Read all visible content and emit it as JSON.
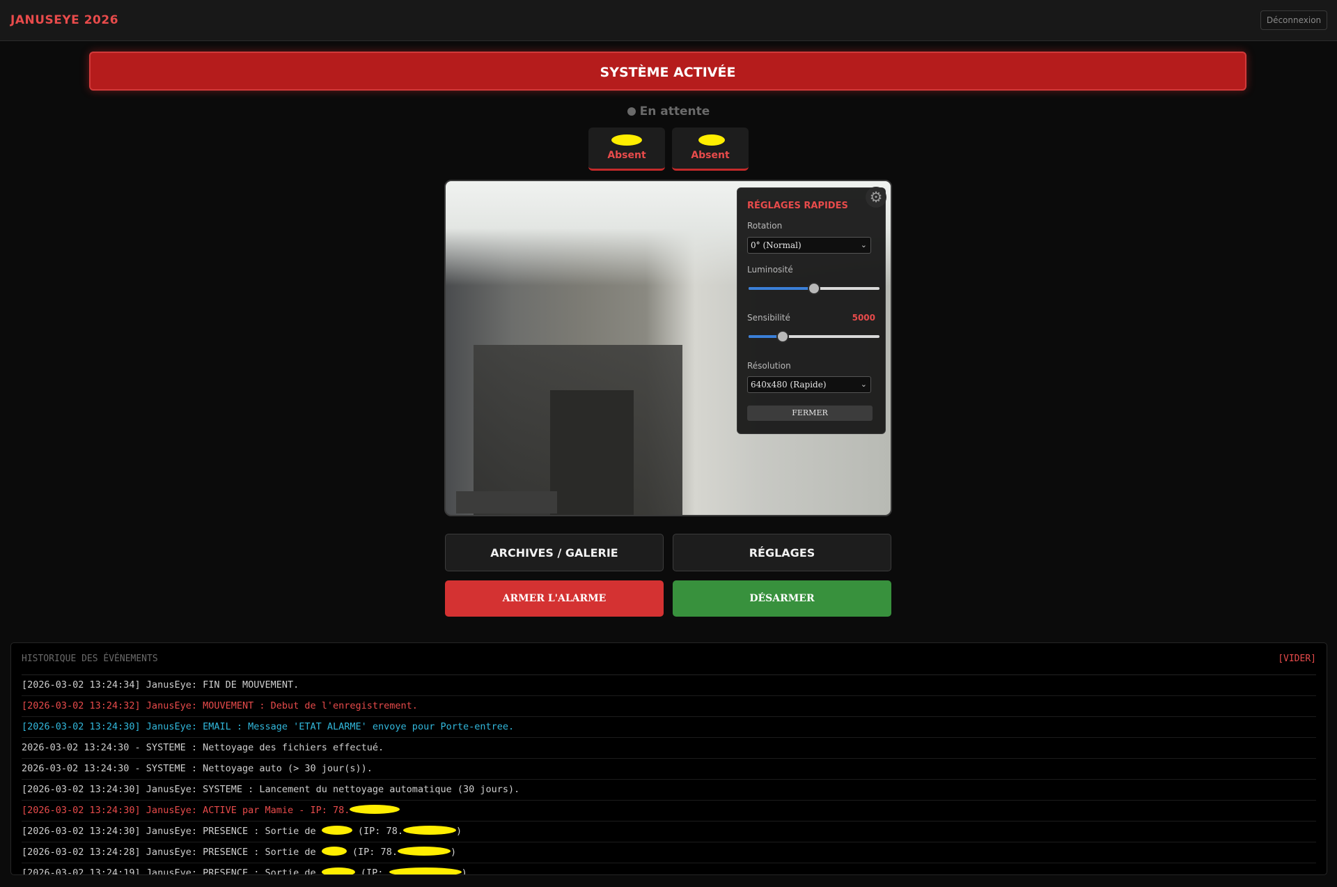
{
  "app": {
    "title": "JANUSEYE 2026",
    "logout_label": "Déconnexion"
  },
  "status": {
    "banner": "SYSTÈME ACTIVÉE",
    "waiting": "En attente"
  },
  "presence": [
    {
      "state": "Absent"
    },
    {
      "state": "Absent"
    }
  ],
  "quick_settings": {
    "title": "RÉGLAGES RAPIDES",
    "rotation_label": "Rotation",
    "rotation_value": "0° (Normal)",
    "brightness_label": "Luminosité",
    "brightness_level": 0.5,
    "sensitivity_label": "Sensibilité",
    "sensitivity_value": "5000",
    "sensitivity_level": 0.26,
    "resolution_label": "Résolution",
    "resolution_value": "640x480 (Rapide)",
    "close_label": "FERMER"
  },
  "actions": {
    "archives_label": "ARCHIVES / GALERIE",
    "settings_label": "RÉGLAGES",
    "arm_label": "ARMER L'ALARME",
    "disarm_label": "DÉSARMER"
  },
  "history": {
    "title": "HISTORIQUE DES ÉVÉNEMENTS",
    "clear_label": "[VIDER]",
    "entries": [
      {
        "text": "[2026-03-02 13:24:34] JanusEye: FIN DE MOUVEMENT.",
        "level": "info"
      },
      {
        "text": "[2026-03-02 13:24:32] JanusEye: MOUVEMENT : Debut de l'enregistrement.",
        "level": "alert"
      },
      {
        "text": "[2026-03-02 13:24:30] JanusEye: EMAIL : Message 'ETAT ALARME' envoye pour Porte-entree.",
        "level": "mail"
      },
      {
        "text": "2026-03-02 13:24:30 - SYSTEME : Nettoyage des fichiers effectué.",
        "level": "info"
      },
      {
        "text": "2026-03-02 13:24:30 - SYSTEME : Nettoyage auto (> 30 jour(s)).",
        "level": "info"
      },
      {
        "text": "[2026-03-02 13:24:30] JanusEye: SYSTEME : Lancement du nettoyage automatique (30 jours).",
        "level": "info"
      },
      {
        "text": "[2026-03-02 13:24:30] JanusEye: ACTIVE par Mamie - IP: 78.",
        "level": "alert"
      },
      {
        "text": "[2026-03-02 13:24:30] JanusEye: PRESENCE : Sortie de",
        "text_mid": "(IP: 78.",
        "text_end": ")",
        "level": "info"
      },
      {
        "text": "[2026-03-02 13:24:28] JanusEye: PRESENCE : Sortie de",
        "text_mid": "(IP: 78.",
        "text_end": ")",
        "level": "info"
      },
      {
        "text": "[2026-03-02 13:24:19] JanusEye: PRESENCE : Sortie de",
        "text_mid": "(IP:",
        "text_end": ")",
        "level": "info"
      }
    ]
  },
  "colors": {
    "accent_red": "#e84b4b",
    "banner_red": "#b51c1c",
    "arm_red": "#d43232",
    "disarm_green": "#38913d",
    "slider_blue": "#3a7fd8",
    "log_cyan": "#32b8dc",
    "redaction_yellow": "#ffee00"
  }
}
